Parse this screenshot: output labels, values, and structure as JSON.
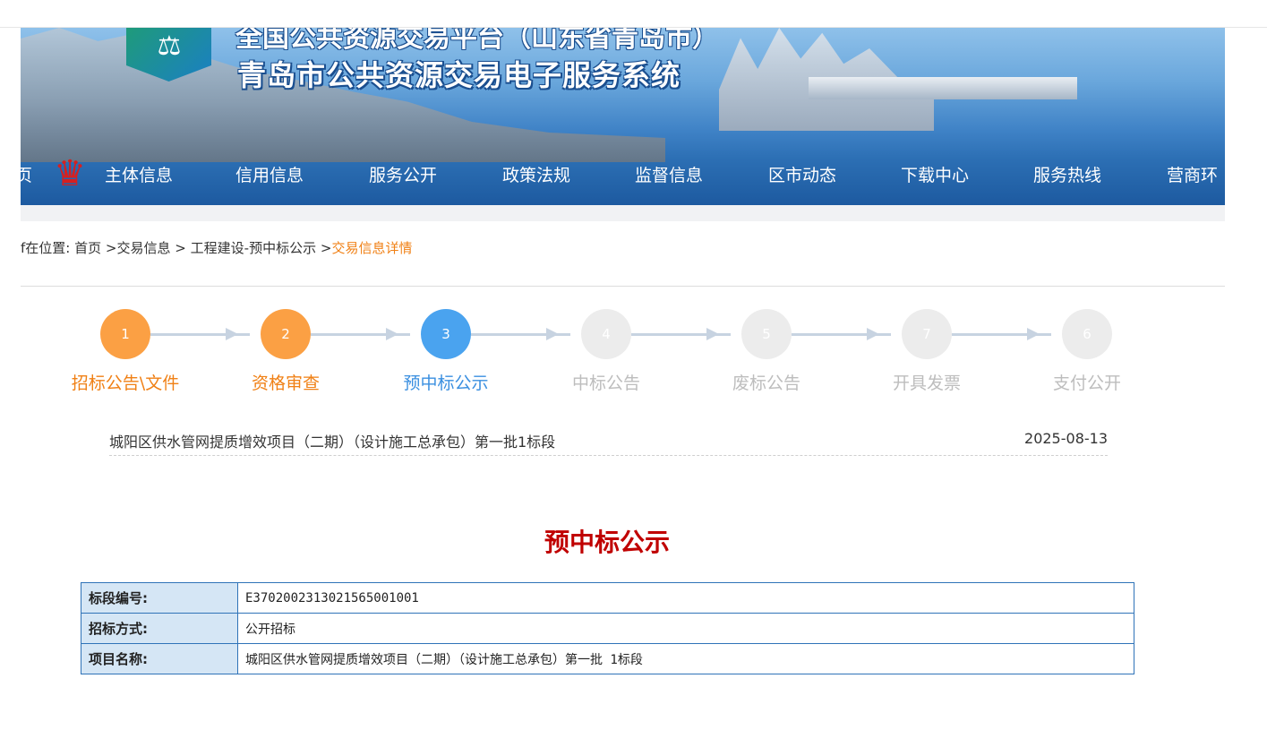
{
  "header": {
    "title_top": "全国公共资源交易平台（山东省青岛市）",
    "title_main": "青岛市公共资源交易电子服务系统"
  },
  "nav": {
    "items": [
      {
        "label": "页"
      },
      {
        "label": "主体信息"
      },
      {
        "label": "信用信息"
      },
      {
        "label": "服务公开"
      },
      {
        "label": "政策法规"
      },
      {
        "label": "监督信息"
      },
      {
        "label": "区市动态"
      },
      {
        "label": "下载中心"
      },
      {
        "label": "服务热线"
      },
      {
        "label": "营商环"
      }
    ]
  },
  "breadcrumb": {
    "prefix": "f在位置:",
    "home": "首页",
    "sep": ">",
    "level1": "交易信息",
    "level2": "工程建设-预中标公示",
    "current": "交易信息详情"
  },
  "steps": [
    {
      "num": "1",
      "label": "招标公告\\文件",
      "state": "done",
      "color": "#fba044",
      "label_color": "#f08015"
    },
    {
      "num": "2",
      "label": "资格审查",
      "state": "done",
      "color": "#fba044",
      "label_color": "#f08015"
    },
    {
      "num": "3",
      "label": "预中标公示",
      "state": "active",
      "color": "#4aa3ef",
      "label_color": "#3a8fe0"
    },
    {
      "num": "4",
      "label": "中标公告",
      "state": "pending",
      "color": "#ececec",
      "label_color": "#bdbdbd"
    },
    {
      "num": "5",
      "label": "废标公告",
      "state": "pending",
      "color": "#ececec",
      "label_color": "#bdbdbd"
    },
    {
      "num": "7",
      "label": "开具发票",
      "state": "pending",
      "color": "#ececec",
      "label_color": "#bdbdbd"
    },
    {
      "num": "6",
      "label": "支付公开",
      "state": "pending",
      "color": "#ececec",
      "label_color": "#bdbdbd"
    }
  ],
  "project": {
    "name": "城阳区供水管网提质增效项目（二期）（设计施工总承包）第一批1标段",
    "date": "2025-08-13"
  },
  "document": {
    "title": "预中标公示",
    "rows": [
      {
        "key": "标段编号:",
        "value": "E3702002313021565001001"
      },
      {
        "key": "招标方式:",
        "value": "公开招标"
      },
      {
        "key": "项目名称:",
        "value": "城阳区供水管网提质增效项目（二期）（设计施工总承包）第一批 1标段"
      }
    ]
  },
  "colors": {
    "accent_orange": "#f08015",
    "accent_blue": "#4aa3ef",
    "title_red": "#c00000",
    "table_border": "#2f73b8"
  }
}
